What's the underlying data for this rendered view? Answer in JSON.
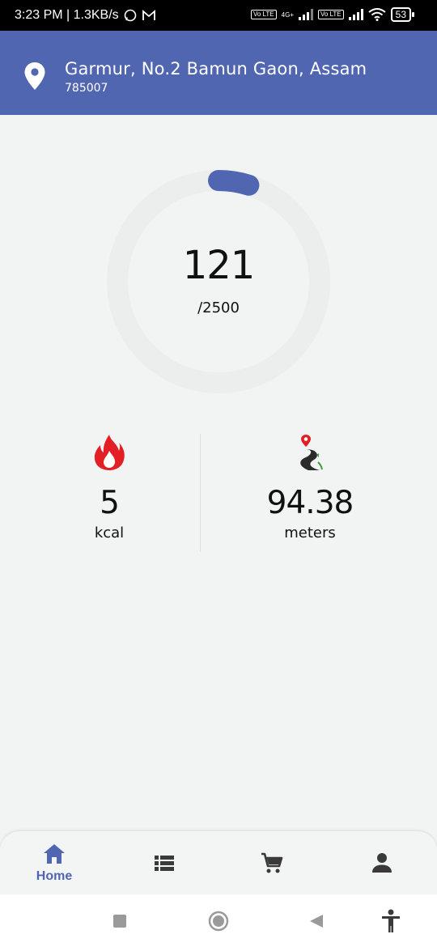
{
  "status_bar": {
    "time_speed": "3:23 PM | 1.3KB/s",
    "network_type": "4G+",
    "volte_label": "Vo LTE",
    "battery_level": "53"
  },
  "header": {
    "location_title": "Garmur, No.2 Bamun Gaon, Assam",
    "location_subtitle": "785007"
  },
  "steps": {
    "count": "121",
    "goal": "/2500",
    "progress": 0.0484,
    "accent_color": "#5166b1",
    "track_color": "#eceeee"
  },
  "stats": {
    "calories": {
      "value": "5",
      "unit": "kcal",
      "icon": "flame-icon"
    },
    "distance": {
      "value": "94.38",
      "unit": "meters",
      "icon": "road-icon"
    }
  },
  "bottom_nav": {
    "items": [
      {
        "label": "Home",
        "icon": "home-icon",
        "active": true
      },
      {
        "label": "",
        "icon": "list-icon",
        "active": false
      },
      {
        "label": "",
        "icon": "cart-icon",
        "active": false
      },
      {
        "label": "",
        "icon": "person-icon",
        "active": false
      }
    ]
  },
  "system_nav": {
    "buttons": [
      "recents-icon",
      "home-circle-icon",
      "back-icon",
      "accessibility-icon"
    ]
  }
}
